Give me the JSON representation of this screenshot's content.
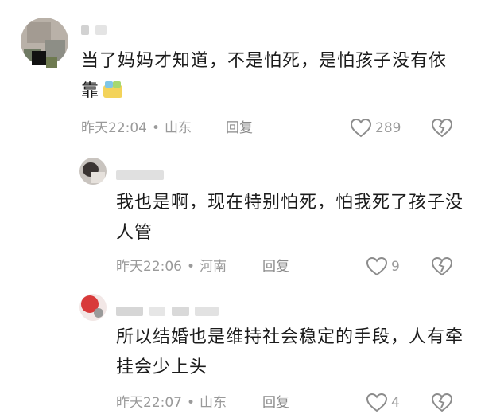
{
  "comments": [
    {
      "text": "当了妈妈才知道，不是怕死，是怕孩子没有依靠",
      "time": "昨天22:04",
      "location": "山东",
      "reply_label": "回复",
      "likes": "289",
      "emoji": "yellow-sticker-emoji"
    },
    {
      "text": "我也是啊，现在特别怕死，怕我死了孩子没人管",
      "time": "昨天22:06",
      "location": "河南",
      "reply_label": "回复",
      "likes": "9"
    },
    {
      "text": "所以结婚也是维持社会稳定的手段，人有牵挂会少上头",
      "time": "昨天22:07",
      "location": "山东",
      "reply_label": "回复",
      "likes": "4"
    }
  ],
  "separator": "•",
  "icons": {
    "like": "heart-outline-icon",
    "dislike": "broken-heart-icon"
  },
  "colors": {
    "text": "#1b1b1b",
    "meta": "#9a9a9a",
    "icon": "#8c8c8c"
  }
}
